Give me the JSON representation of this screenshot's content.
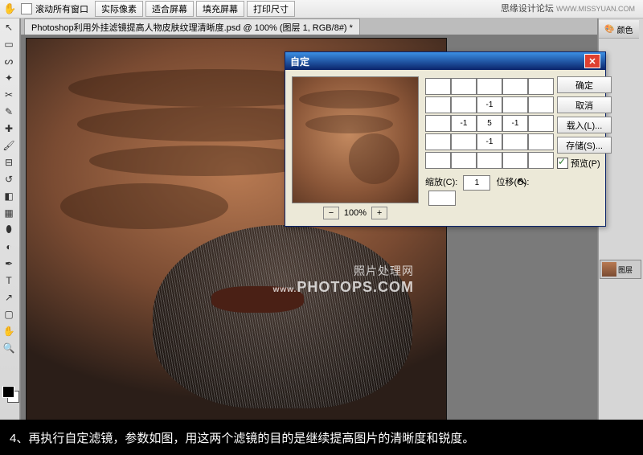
{
  "topbar": {
    "scroll_all_label": "滚动所有窗口",
    "buttons": [
      "实际像素",
      "适合屏幕",
      "填充屏幕",
      "打印尺寸"
    ]
  },
  "branding": {
    "site": "思缘设计论坛",
    "url": "WWW.MISSYUAN.COM"
  },
  "doc_tab": "Photoshop利用外挂滤镜提高人物皮肤纹理清晰度.psd @ 100% (图层 1, RGB/8#) *",
  "right_panel": {
    "color_label": "颜色",
    "layer_label": "图层"
  },
  "dialog": {
    "title": "自定",
    "ok": "确定",
    "cancel": "取消",
    "load": "载入(L)...",
    "save": "存储(S)...",
    "preview": "预览(P)",
    "zoom": "100%",
    "matrix": [
      [
        "",
        "",
        "",
        "",
        ""
      ],
      [
        "",
        "",
        "-1",
        "",
        ""
      ],
      [
        "",
        "-1",
        "5",
        "-1",
        ""
      ],
      [
        "",
        "",
        "-1",
        "",
        ""
      ],
      [
        "",
        "",
        "",
        "",
        ""
      ]
    ],
    "scale_label": "缩放(C):",
    "scale_value": "1",
    "offset_label": "位移(O):",
    "offset_value": ""
  },
  "watermark": {
    "cn": "照片处理网",
    "en": "PHOTOPS.COM",
    "sub": "www."
  },
  "caption": "4、再执行自定滤镜，参数如图，用这两个滤镜的目的是继续提高图片的清晰度和锐度。"
}
